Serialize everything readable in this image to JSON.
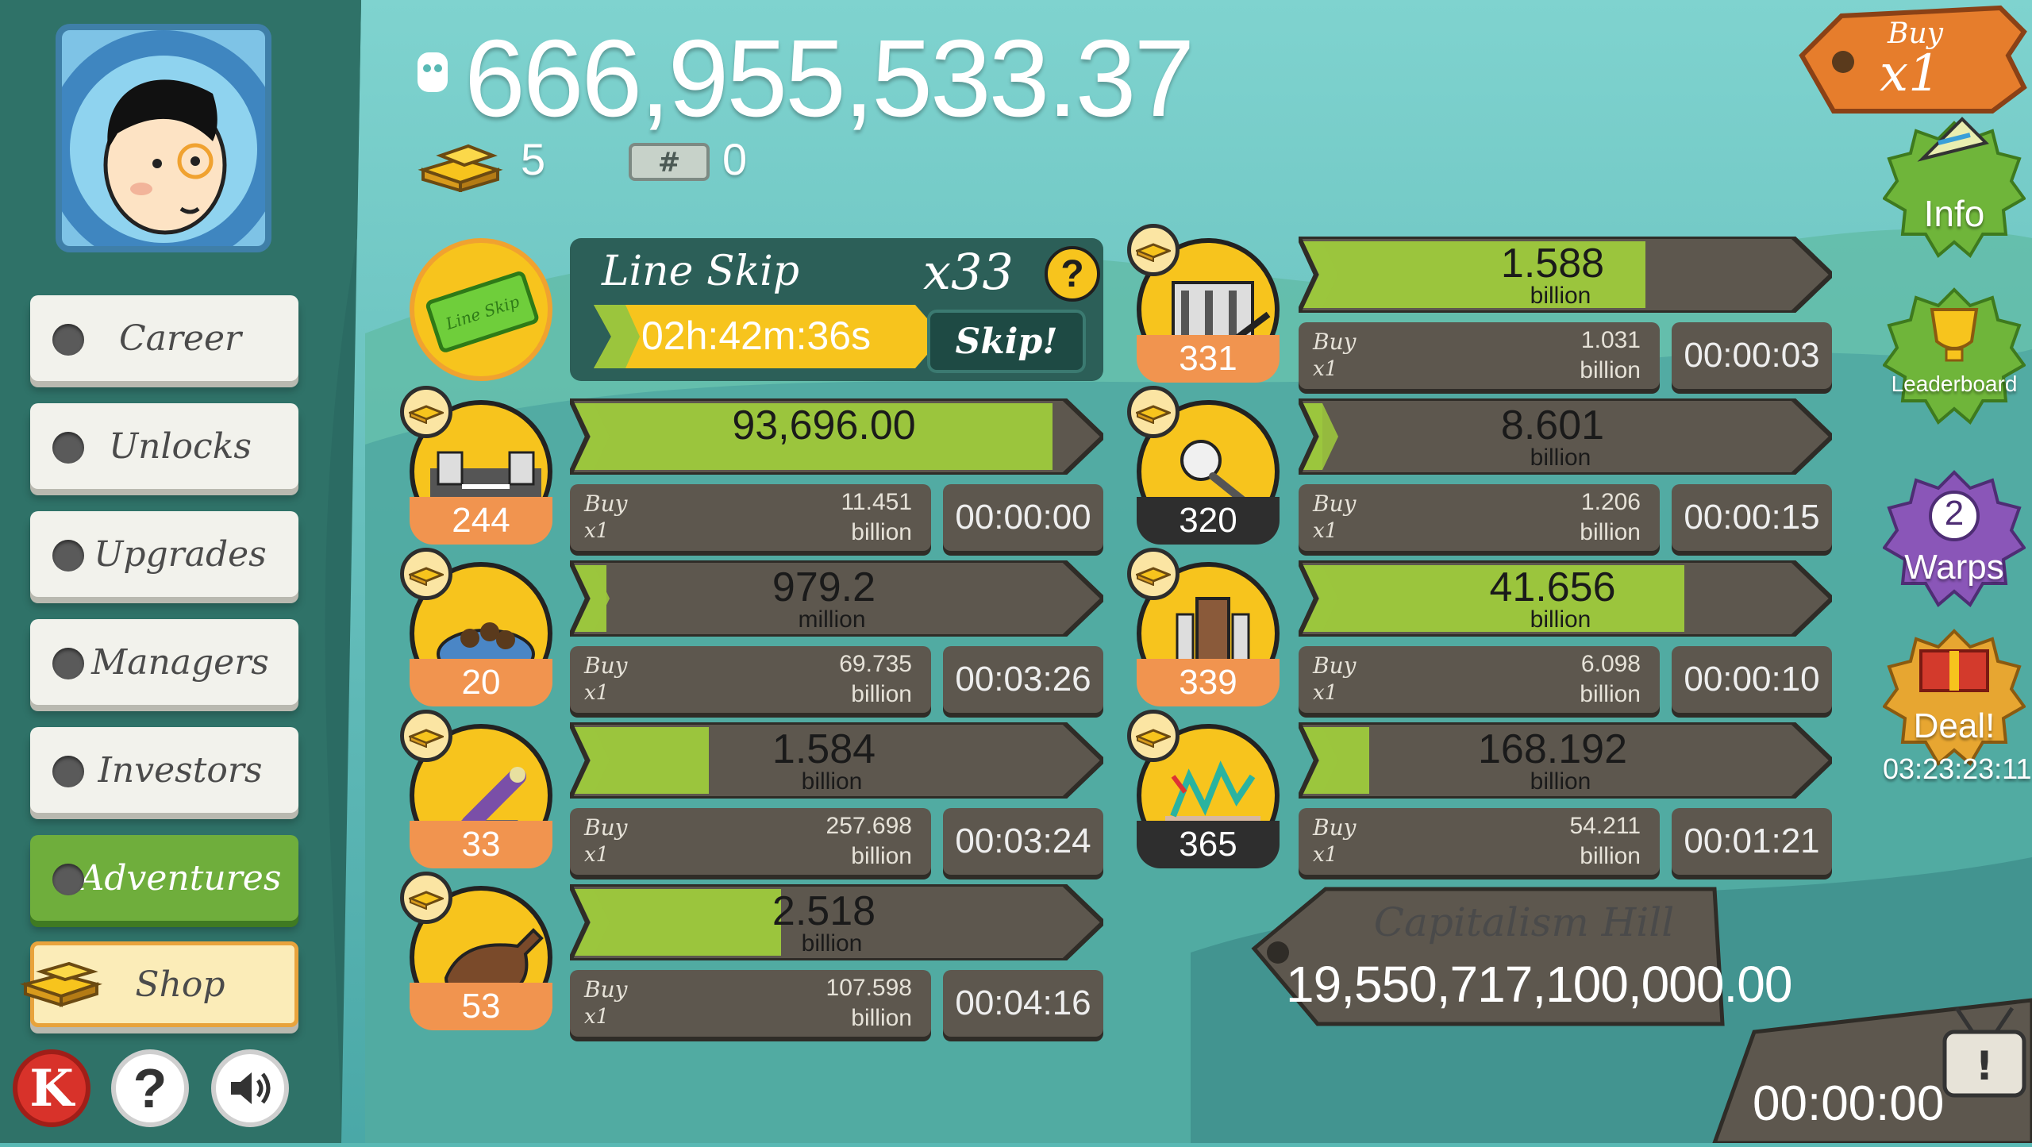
{
  "money": "666,955,533.37",
  "gold_count": "5",
  "ticket_count": "0",
  "nav": {
    "career": "Career",
    "unlocks": "Unlocks",
    "upgrades": "Upgrades",
    "managers": "Managers",
    "investors": "Investors",
    "adventures": "Adventures",
    "shop": "Shop"
  },
  "bottom_icons": {
    "k": "K",
    "help": "?",
    "sound": "sound-icon"
  },
  "line_skip": {
    "title": "Line Skip",
    "multiplier": "x33",
    "help": "?",
    "timer": "02h:42m:36s",
    "skip_label": "Skip!",
    "icon_text": "Line Skip"
  },
  "buy_label_top": "Buy",
  "buy_label_bottom": "x1",
  "businesses_left": [
    {
      "count": "244",
      "count_style": "orange",
      "value": "93,696.00",
      "unit": "",
      "progress": 0.96,
      "cost": "11.451",
      "cost_unit": "billion",
      "time": "00:00:00"
    },
    {
      "count": "20",
      "count_style": "orange",
      "value": "979.2",
      "unit": "million",
      "progress": 0.04,
      "cost": "69.735",
      "cost_unit": "billion",
      "time": "00:03:26"
    },
    {
      "count": "33",
      "count_style": "orange",
      "value": "1.584",
      "unit": "billion",
      "progress": 0.25,
      "cost": "257.698",
      "cost_unit": "billion",
      "time": "00:03:24"
    },
    {
      "count": "53",
      "count_style": "orange",
      "value": "2.518",
      "unit": "billion",
      "progress": 0.4,
      "cost": "107.598",
      "cost_unit": "billion",
      "time": "00:04:16"
    }
  ],
  "businesses_right": [
    {
      "count": "331",
      "count_style": "orange",
      "value": "1.588",
      "unit": "billion",
      "progress": 0.68,
      "cost": "1.031",
      "cost_unit": "billion",
      "time": "00:00:03"
    },
    {
      "count": "320",
      "count_style": "dark",
      "value": "8.601",
      "unit": "billion",
      "progress": 0.0,
      "cost": "1.206",
      "cost_unit": "billion",
      "time": "00:00:15"
    },
    {
      "count": "339",
      "count_style": "orange",
      "value": "41.656",
      "unit": "billion",
      "progress": 0.76,
      "cost": "6.098",
      "cost_unit": "billion",
      "time": "00:00:10"
    },
    {
      "count": "365",
      "count_style": "dark",
      "value": "168.192",
      "unit": "billion",
      "progress": 0.11,
      "cost": "54.211",
      "cost_unit": "billion",
      "time": "00:01:21"
    }
  ],
  "buy_multiplier": {
    "top": "Buy",
    "bottom": "x1"
  },
  "right_badges": {
    "info": "Info",
    "leaderboard": "Leaderboard",
    "warps_count": "2",
    "warps": "Warps",
    "deal": "Deal!",
    "deal_timer": "03:23:23:11"
  },
  "location": {
    "name": "Capitalism Hill",
    "amount": "19,550,717,100,000.00"
  },
  "tv_timer": "00:00:00",
  "colors": {
    "green": "#9bc53d",
    "bar_bg": "#5d574e",
    "yellow": "#f7c41d",
    "orange": "#f1944f"
  }
}
